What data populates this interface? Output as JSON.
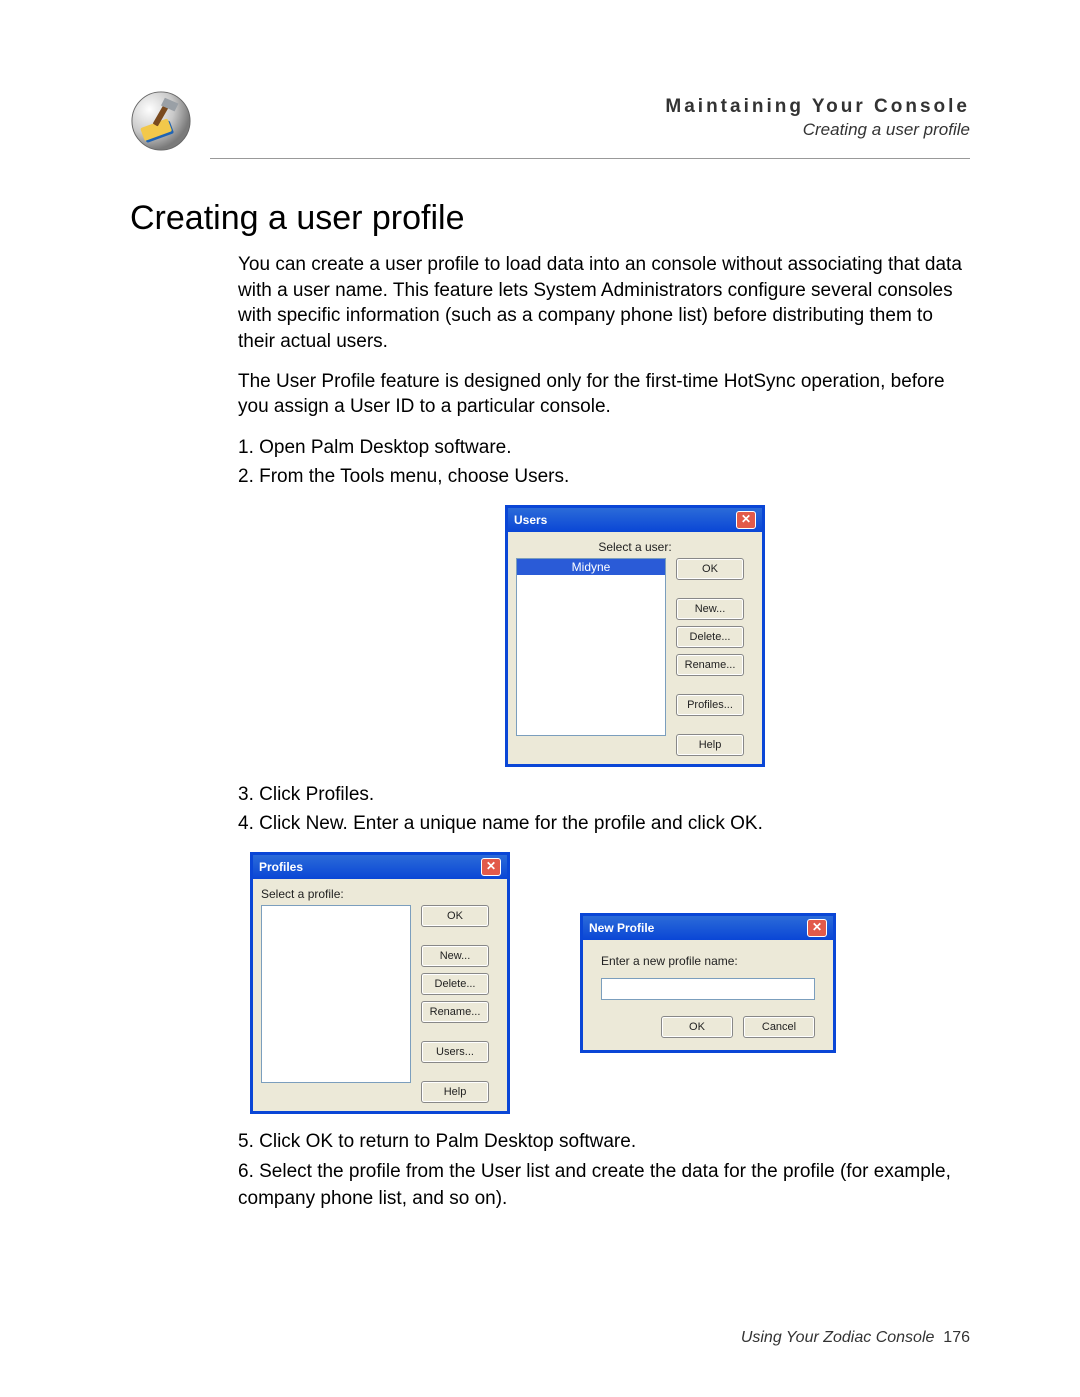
{
  "header": {
    "chapter": "Maintaining Your Console",
    "breadcrumb": "Creating a user profile"
  },
  "section_title": "Creating a user profile",
  "intro": {
    "p1": "You can create a user profile to load data into an console without associating that data with a user name. This feature lets System Administrators configure several consoles with specific information (such as a company phone list) before distributing them to their actual users.",
    "p2": "The User Profile feature is designed only for the first-time HotSync operation, before you assign a User ID to a particular console."
  },
  "steps": {
    "s1": "Open Palm Desktop software.",
    "s2": "From the Tools menu, choose Users.",
    "s3": "Click Profiles.",
    "s4": "Click New. Enter a unique name for the profile and click OK.",
    "s5": "Click OK to return to Palm Desktop software.",
    "s6": "Select the profile from the User list and create the data for the profile (for example, company phone list, and so on)."
  },
  "dialogs": {
    "users": {
      "title": "Users",
      "label": "Select a user:",
      "selected": "Midyne",
      "buttons": {
        "ok": "OK",
        "new": "New...",
        "delete": "Delete...",
        "rename": "Rename...",
        "profiles": "Profiles...",
        "help": "Help"
      }
    },
    "profiles": {
      "title": "Profiles",
      "label": "Select a profile:",
      "buttons": {
        "ok": "OK",
        "new": "New...",
        "delete": "Delete...",
        "rename": "Rename...",
        "users": "Users...",
        "help": "Help"
      }
    },
    "newprofile": {
      "title": "New Profile",
      "label": "Enter a new profile name:",
      "value": "",
      "buttons": {
        "ok": "OK",
        "cancel": "Cancel"
      }
    }
  },
  "footer": {
    "text": "Using Your Zodiac Console",
    "page": "176"
  }
}
